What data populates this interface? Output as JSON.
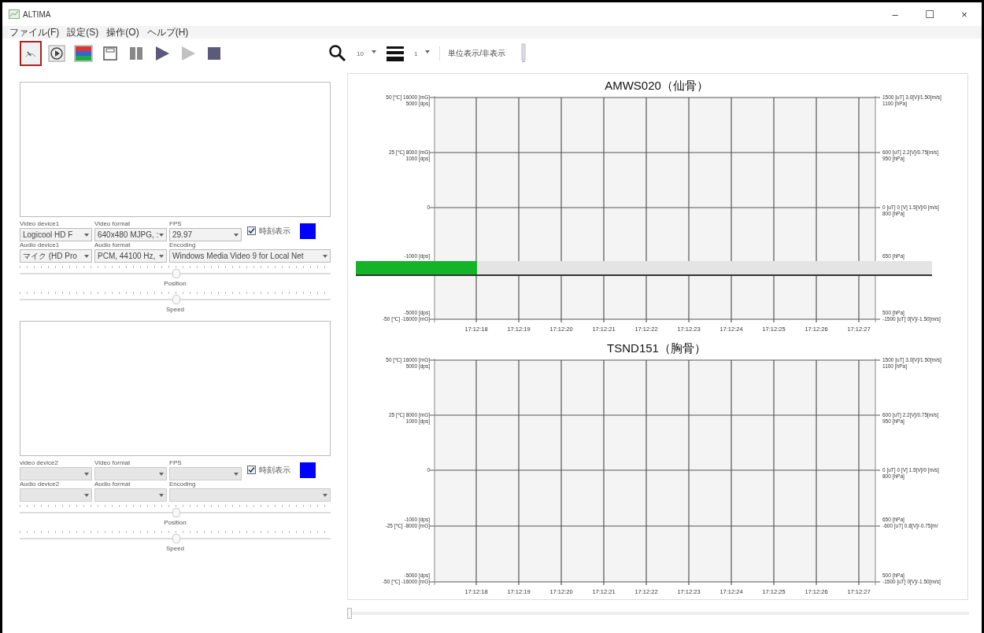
{
  "window": {
    "title": "ALTIMA",
    "controls": [
      "–",
      "☐",
      "×"
    ]
  },
  "menu": [
    "ファイル(F)",
    "設定(S)",
    "操作(O)",
    "ヘルプ(H)"
  ],
  "toolbar": {
    "tools": [
      {
        "kind": "gauge",
        "selected": true,
        "disabled": false
      },
      {
        "kind": "play-circle",
        "selected": false,
        "disabled": false
      },
      {
        "kind": "chart",
        "selected": false,
        "disabled": false
      },
      {
        "kind": "window",
        "selected": false,
        "disabled": false
      },
      {
        "kind": "columns",
        "selected": false,
        "disabled": false
      },
      {
        "kind": "play",
        "selected": false,
        "disabled": false
      },
      {
        "kind": "play",
        "selected": false,
        "disabled": true
      },
      {
        "kind": "stop",
        "selected": false,
        "disabled": false
      }
    ],
    "zoom_value": "10",
    "lines_value": "1",
    "unit_button": "単位表示/非表示"
  },
  "video_panels": [
    {
      "labels": [
        "Video device1",
        "Video format",
        "FPS",
        "Audio device1",
        "Audio format",
        "Encoding"
      ],
      "combos": [
        {
          "value": "Logicool HD F",
          "disabled": false
        },
        {
          "value": "640x480 MJPG, :",
          "disabled": false
        },
        {
          "value": "29.97",
          "disabled": false
        },
        {
          "value": "マイク (HD Pro",
          "disabled": false
        },
        {
          "value": "PCM, 44100 Hz,",
          "disabled": false
        },
        {
          "value": "Windows Media Video 9 for Local Net",
          "disabled": false
        }
      ],
      "checkbox": {
        "label": "時刻表示",
        "checked": true
      },
      "color": "#0000ff",
      "position": {
        "label": "Position",
        "level": 0.5
      },
      "speed": {
        "label": "Speed",
        "level": 0.5
      }
    },
    {
      "labels": [
        "video device2",
        "Video format",
        "FPS",
        "Audio device2",
        "Audio format",
        "Encoding"
      ],
      "combos": [
        {
          "disabled": true
        },
        {
          "disabled": true
        },
        {
          "disabled": true
        },
        {
          "disabled": true
        },
        {
          "disabled": true
        },
        {
          "disabled": true
        }
      ],
      "checkbox": {
        "label": "時刻表示",
        "checked": true
      },
      "color": "#0000ff",
      "position": {
        "label": "Position",
        "level": 0.5
      },
      "speed": {
        "label": "Speed",
        "level": 0.5
      }
    }
  ],
  "charts": [
    {
      "title": "AMWS020（仙骨）",
      "left_labels": [
        [
          "50 [℃]  16000 [mG]",
          "5000 [dps]"
        ],
        [
          "25 [℃]  8000 [mG]",
          "1000 [dps]"
        ],
        [
          "0"
        ],
        [
          "-1000 [dps]"
        ],
        [
          "-5000 [dps]",
          "-50 [℃]  -16000 [mG]"
        ]
      ],
      "right_labels": [
        [
          "1500 [uT]   3.0[V]/1.50[m/s]",
          "1100 [hPa]"
        ],
        [
          "600 [uT]   2.2[V]/0.75[m/s]",
          "950 [hPa]"
        ],
        [
          "0 [uT] 0 [V] 1.5[V]/0 [m/s]",
          "800 [hPa]"
        ],
        [
          "650 [hPa]"
        ],
        [
          "500 [hPa]",
          "-1500 [uT]   0[V]/-1.50[m/s]"
        ]
      ],
      "x_labels": [
        "17:12:18",
        "17:12:19",
        "17:12:20",
        "17:12:21",
        "17:12:22",
        "17:12:23",
        "17:12:24",
        "17:12:25",
        "17:12:26",
        "17:12:27"
      ],
      "progress": {
        "level": 0.21
      }
    },
    {
      "title": "TSND151（胸骨）",
      "left_labels": [
        [
          "50 [℃]  16000 [mG]",
          "5000 [dps]"
        ],
        [
          "25 [℃]  8000 [mG]",
          "1000 [dps]"
        ],
        [
          "0"
        ],
        [
          "-1000 [dps]",
          "-25 [℃]  -8000 [mG]"
        ],
        [
          "-5000 [dps]",
          "-50 [℃]  -16000 [mG]"
        ]
      ],
      "right_labels": [
        [
          "1500 [uT]   3.0[V]/1.50[m/s]",
          "1100 [hPa]"
        ],
        [
          "600 [uT]   2.2[V]/0.75[m/s]",
          "950 [hPa]"
        ],
        [
          "0 [uT] 0 [V] 1.5[V]/0 [m/s]",
          "800 [hPa]"
        ],
        [
          "650 [hPa]",
          "-600 [uT]   0.8[V]/-0.75[m/"
        ],
        [
          "500 [hPa]",
          "-1500 [uT]   0[V]/-1.50[m/s]"
        ]
      ],
      "x_labels": [
        "17:12:18",
        "17:12:19",
        "17:12:20",
        "17:12:21",
        "17:12:22",
        "17:12:23",
        "17:12:24",
        "17:12:25",
        "17:12:26",
        "17:12:27"
      ]
    }
  ],
  "timeline": {
    "level": 0
  }
}
